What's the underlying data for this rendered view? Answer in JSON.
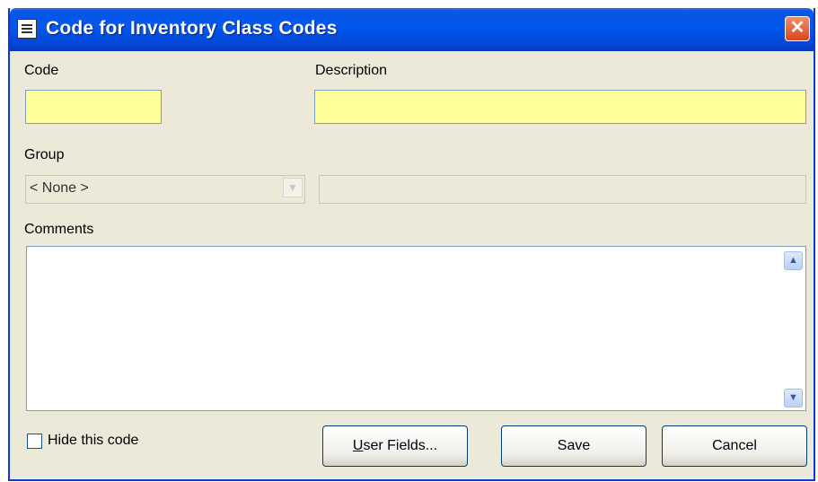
{
  "window": {
    "title": "Code for Inventory Class Codes",
    "close_glyph": "✕"
  },
  "form": {
    "code_label": "Code",
    "code_value": "",
    "description_label": "Description",
    "description_value": "",
    "group_label": "Group",
    "group_selected": "< None >",
    "group_description_value": "",
    "comments_label": "Comments",
    "comments_value": "",
    "hide_label": "Hide this code",
    "hide_checked": false
  },
  "buttons": {
    "user_fields_mnemonic": "U",
    "user_fields_rest": "ser Fields...",
    "save": "Save",
    "cancel": "Cancel"
  },
  "colors": {
    "required_field": "#ffff99",
    "title_bar": "#0058ee",
    "dialog_bg": "#ece9d8"
  }
}
